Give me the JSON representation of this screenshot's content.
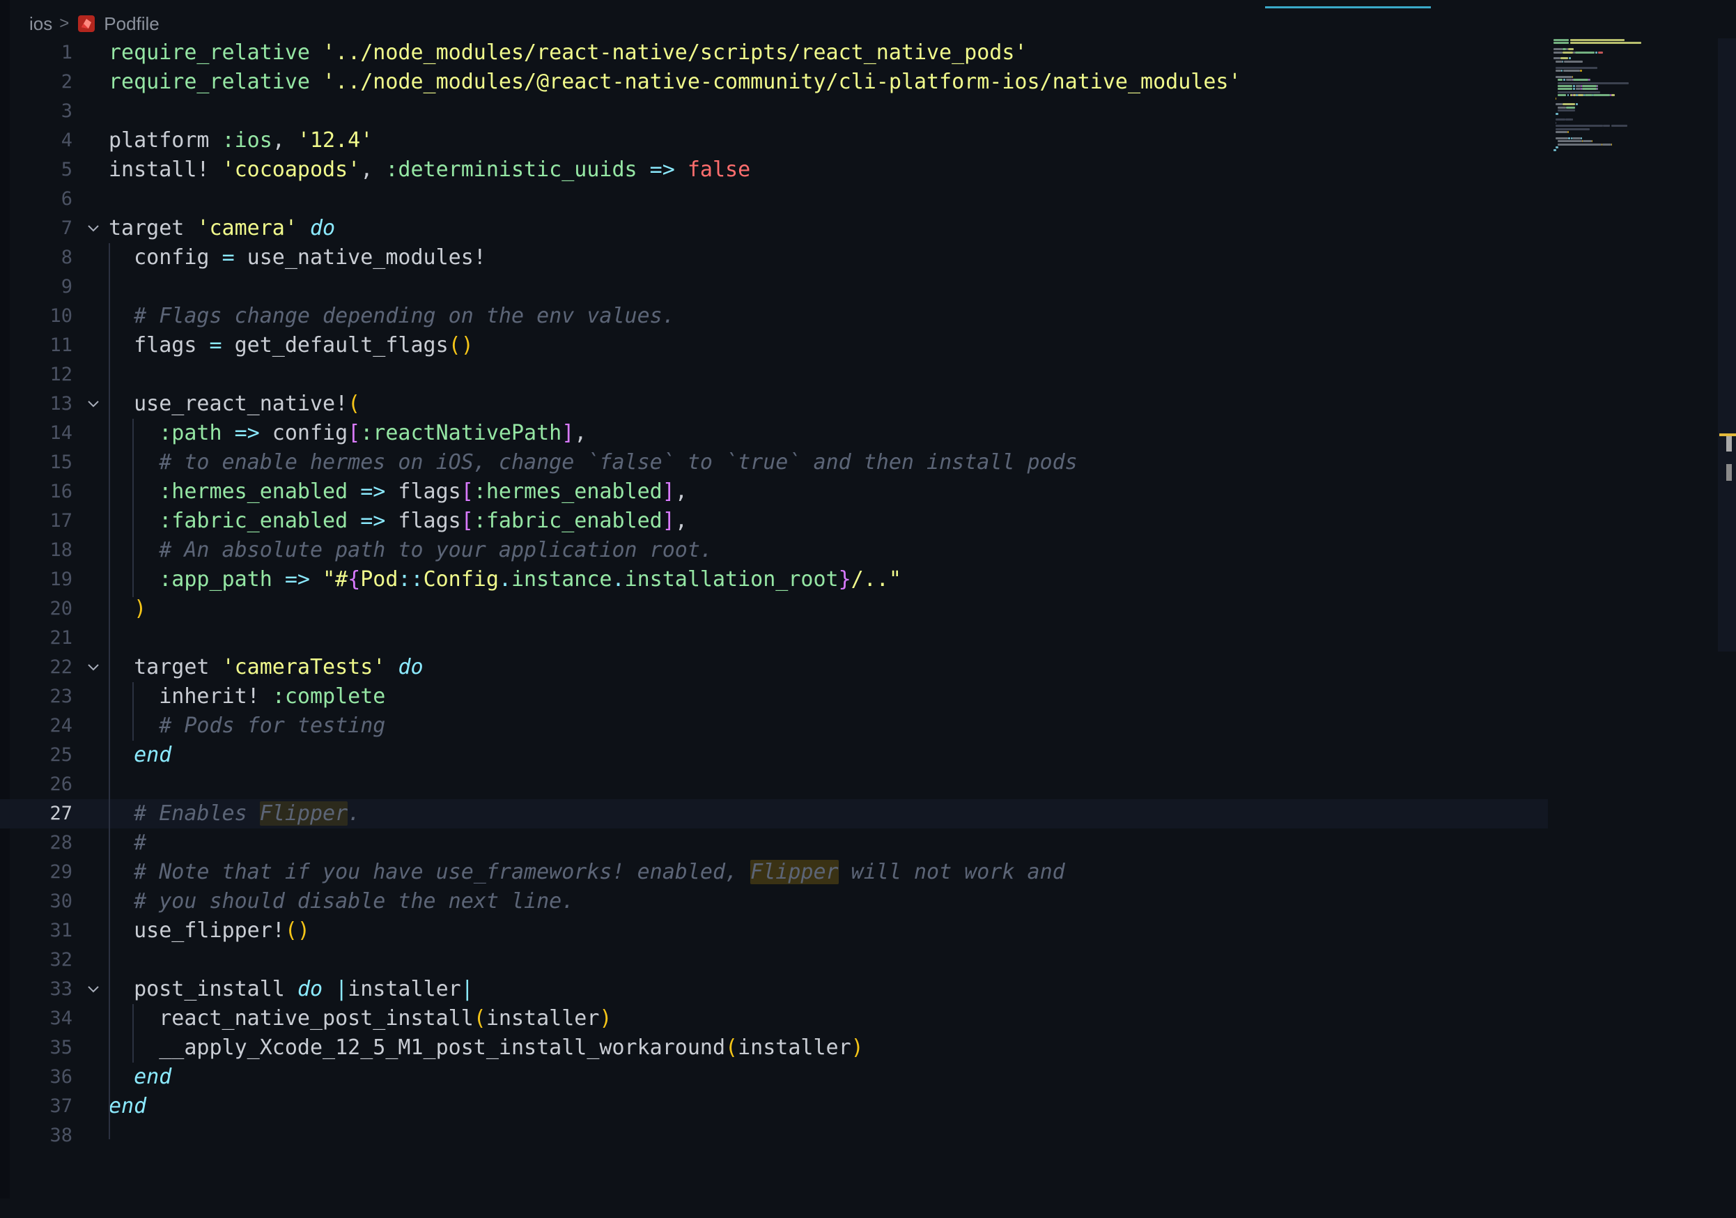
{
  "breadcrumb": {
    "folder": "ios",
    "file": "Podfile",
    "separator": ">"
  },
  "editor": {
    "current_line": 27,
    "lines": [
      {
        "n": "1",
        "fold": false,
        "tokens": [
          [
            "require_relative",
            "fn"
          ],
          [
            " ",
            "plain"
          ],
          [
            "'../node_modules/react-native/scripts/react_native_pods'",
            "str"
          ]
        ]
      },
      {
        "n": "2",
        "fold": false,
        "tokens": [
          [
            "require_relative",
            "fn"
          ],
          [
            " ",
            "plain"
          ],
          [
            "'../node_modules/@react-native-community/cli-platform-ios/native_modules'",
            "str"
          ]
        ]
      },
      {
        "n": "3",
        "fold": false,
        "tokens": []
      },
      {
        "n": "4",
        "fold": false,
        "tokens": [
          [
            "platform ",
            "plain"
          ],
          [
            ":ios",
            "sym"
          ],
          [
            ", ",
            "punc"
          ],
          [
            "'12.4'",
            "str"
          ]
        ]
      },
      {
        "n": "5",
        "fold": false,
        "tokens": [
          [
            "install! ",
            "plain"
          ],
          [
            "'cocoapods'",
            "str"
          ],
          [
            ", ",
            "punc"
          ],
          [
            ":deterministic_uuids",
            "sym"
          ],
          [
            " ",
            "plain"
          ],
          [
            "=>",
            "op"
          ],
          [
            " ",
            "plain"
          ],
          [
            "false",
            "bool"
          ]
        ]
      },
      {
        "n": "6",
        "fold": false,
        "tokens": []
      },
      {
        "n": "7",
        "fold": true,
        "tokens": [
          [
            "target ",
            "plain"
          ],
          [
            "'camera'",
            "str"
          ],
          [
            " ",
            "plain"
          ],
          [
            "do",
            "kw"
          ]
        ]
      },
      {
        "n": "8",
        "fold": false,
        "tokens": [
          [
            "  config ",
            "plain"
          ],
          [
            "=",
            "op"
          ],
          [
            " use_native_modules!",
            "plain"
          ]
        ]
      },
      {
        "n": "9",
        "fold": false,
        "tokens": []
      },
      {
        "n": "10",
        "fold": false,
        "tokens": [
          [
            "  ",
            "plain"
          ],
          [
            "# Flags change depending on the env values.",
            "com"
          ]
        ]
      },
      {
        "n": "11",
        "fold": false,
        "tokens": [
          [
            "  flags ",
            "plain"
          ],
          [
            "=",
            "op"
          ],
          [
            " get_default_flags",
            "plain"
          ],
          [
            "()",
            "br1"
          ]
        ]
      },
      {
        "n": "12",
        "fold": false,
        "tokens": []
      },
      {
        "n": "13",
        "fold": true,
        "tokens": [
          [
            "  use_react_native!",
            "plain"
          ],
          [
            "(",
            "br1"
          ]
        ]
      },
      {
        "n": "14",
        "fold": false,
        "tokens": [
          [
            "    ",
            "plain"
          ],
          [
            ":path",
            "sym"
          ],
          [
            " ",
            "plain"
          ],
          [
            "=>",
            "op"
          ],
          [
            " config",
            "plain"
          ],
          [
            "[",
            "br2"
          ],
          [
            ":reactNativePath",
            "sym"
          ],
          [
            "]",
            "br2"
          ],
          [
            ",",
            "punc"
          ]
        ]
      },
      {
        "n": "15",
        "fold": false,
        "tokens": [
          [
            "    ",
            "plain"
          ],
          [
            "# to enable hermes on iOS, change `false` to `true` and then install pods",
            "com"
          ]
        ]
      },
      {
        "n": "16",
        "fold": false,
        "tokens": [
          [
            "    ",
            "plain"
          ],
          [
            ":hermes_enabled",
            "sym"
          ],
          [
            " ",
            "plain"
          ],
          [
            "=>",
            "op"
          ],
          [
            " flags",
            "plain"
          ],
          [
            "[",
            "br2"
          ],
          [
            ":hermes_enabled",
            "sym"
          ],
          [
            "]",
            "br2"
          ],
          [
            ",",
            "punc"
          ]
        ]
      },
      {
        "n": "17",
        "fold": false,
        "tokens": [
          [
            "    ",
            "plain"
          ],
          [
            ":fabric_enabled",
            "sym"
          ],
          [
            " ",
            "plain"
          ],
          [
            "=>",
            "op"
          ],
          [
            " flags",
            "plain"
          ],
          [
            "[",
            "br2"
          ],
          [
            ":fabric_enabled",
            "sym"
          ],
          [
            "]",
            "br2"
          ],
          [
            ",",
            "punc"
          ]
        ]
      },
      {
        "n": "18",
        "fold": false,
        "tokens": [
          [
            "    ",
            "plain"
          ],
          [
            "# An absolute path to your application root.",
            "com"
          ]
        ]
      },
      {
        "n": "19",
        "fold": false,
        "tokens": [
          [
            "    ",
            "plain"
          ],
          [
            ":app_path",
            "sym"
          ],
          [
            " ",
            "plain"
          ],
          [
            "=>",
            "op"
          ],
          [
            " ",
            "plain"
          ],
          [
            "\"#",
            "str"
          ],
          [
            "{",
            "br2"
          ],
          [
            "Pod",
            "const"
          ],
          [
            "::",
            "op"
          ],
          [
            "Config",
            "const"
          ],
          [
            ".",
            "op"
          ],
          [
            "instance",
            "sym"
          ],
          [
            ".",
            "op"
          ],
          [
            "installation_root",
            "sym"
          ],
          [
            "}",
            "br2"
          ],
          [
            "/..\"",
            "str"
          ]
        ]
      },
      {
        "n": "20",
        "fold": false,
        "tokens": [
          [
            "  ",
            "plain"
          ],
          [
            ")",
            "br1"
          ]
        ]
      },
      {
        "n": "21",
        "fold": false,
        "tokens": []
      },
      {
        "n": "22",
        "fold": true,
        "tokens": [
          [
            "  target ",
            "plain"
          ],
          [
            "'cameraTests'",
            "str"
          ],
          [
            " ",
            "plain"
          ],
          [
            "do",
            "kw"
          ]
        ]
      },
      {
        "n": "23",
        "fold": false,
        "tokens": [
          [
            "    inherit! ",
            "plain"
          ],
          [
            ":complete",
            "sym"
          ]
        ]
      },
      {
        "n": "24",
        "fold": false,
        "tokens": [
          [
            "    ",
            "plain"
          ],
          [
            "# Pods for testing",
            "com"
          ]
        ]
      },
      {
        "n": "25",
        "fold": false,
        "tokens": [
          [
            "  ",
            "plain"
          ],
          [
            "end",
            "kw"
          ]
        ]
      },
      {
        "n": "26",
        "fold": false,
        "tokens": []
      },
      {
        "n": "27",
        "fold": false,
        "tokens": [
          [
            "  ",
            "plain"
          ],
          [
            "# Enables ",
            "com"
          ],
          [
            "Flipper",
            "com hl"
          ],
          [
            ".",
            "com"
          ]
        ]
      },
      {
        "n": "28",
        "fold": false,
        "tokens": [
          [
            "  ",
            "plain"
          ],
          [
            "#",
            "com"
          ]
        ]
      },
      {
        "n": "29",
        "fold": false,
        "tokens": [
          [
            "  ",
            "plain"
          ],
          [
            "# Note that if you have use_frameworks! enabled, ",
            "com"
          ],
          [
            "Flipper",
            "com hl2"
          ],
          [
            " will not work and",
            "com"
          ]
        ]
      },
      {
        "n": "30",
        "fold": false,
        "tokens": [
          [
            "  ",
            "plain"
          ],
          [
            "# you should disable the next line.",
            "com"
          ]
        ]
      },
      {
        "n": "31",
        "fold": false,
        "tokens": [
          [
            "  use_flipper!",
            "plain"
          ],
          [
            "()",
            "br1"
          ]
        ]
      },
      {
        "n": "32",
        "fold": false,
        "tokens": []
      },
      {
        "n": "33",
        "fold": true,
        "tokens": [
          [
            "  post_install ",
            "plain"
          ],
          [
            "do",
            "kw"
          ],
          [
            " ",
            "plain"
          ],
          [
            "|",
            "op"
          ],
          [
            "installer",
            "plain"
          ],
          [
            "|",
            "op"
          ]
        ]
      },
      {
        "n": "34",
        "fold": false,
        "tokens": [
          [
            "    react_native_post_install",
            "plain"
          ],
          [
            "(",
            "br1"
          ],
          [
            "installer",
            "plain"
          ],
          [
            ")",
            "br1"
          ]
        ]
      },
      {
        "n": "35",
        "fold": false,
        "tokens": [
          [
            "    __apply_Xcode_12_5_M1_post_install_workaround",
            "plain"
          ],
          [
            "(",
            "br1"
          ],
          [
            "installer",
            "plain"
          ],
          [
            ")",
            "br1"
          ]
        ]
      },
      {
        "n": "36",
        "fold": false,
        "tokens": [
          [
            "  ",
            "plain"
          ],
          [
            "end",
            "kw"
          ]
        ]
      },
      {
        "n": "37",
        "fold": false,
        "tokens": [
          [
            "end",
            "kw"
          ]
        ]
      },
      {
        "n": "38",
        "fold": false,
        "tokens": []
      }
    ]
  },
  "icons": {
    "file_icon": "ruby-gem-icon",
    "fold_icon": "chevron-down-icon"
  },
  "colors": {
    "background": "#0d1117",
    "string": "#f1fa8c",
    "keyword": "#8be9fd",
    "comment": "#5c6577",
    "false": "#ff6e6e"
  }
}
